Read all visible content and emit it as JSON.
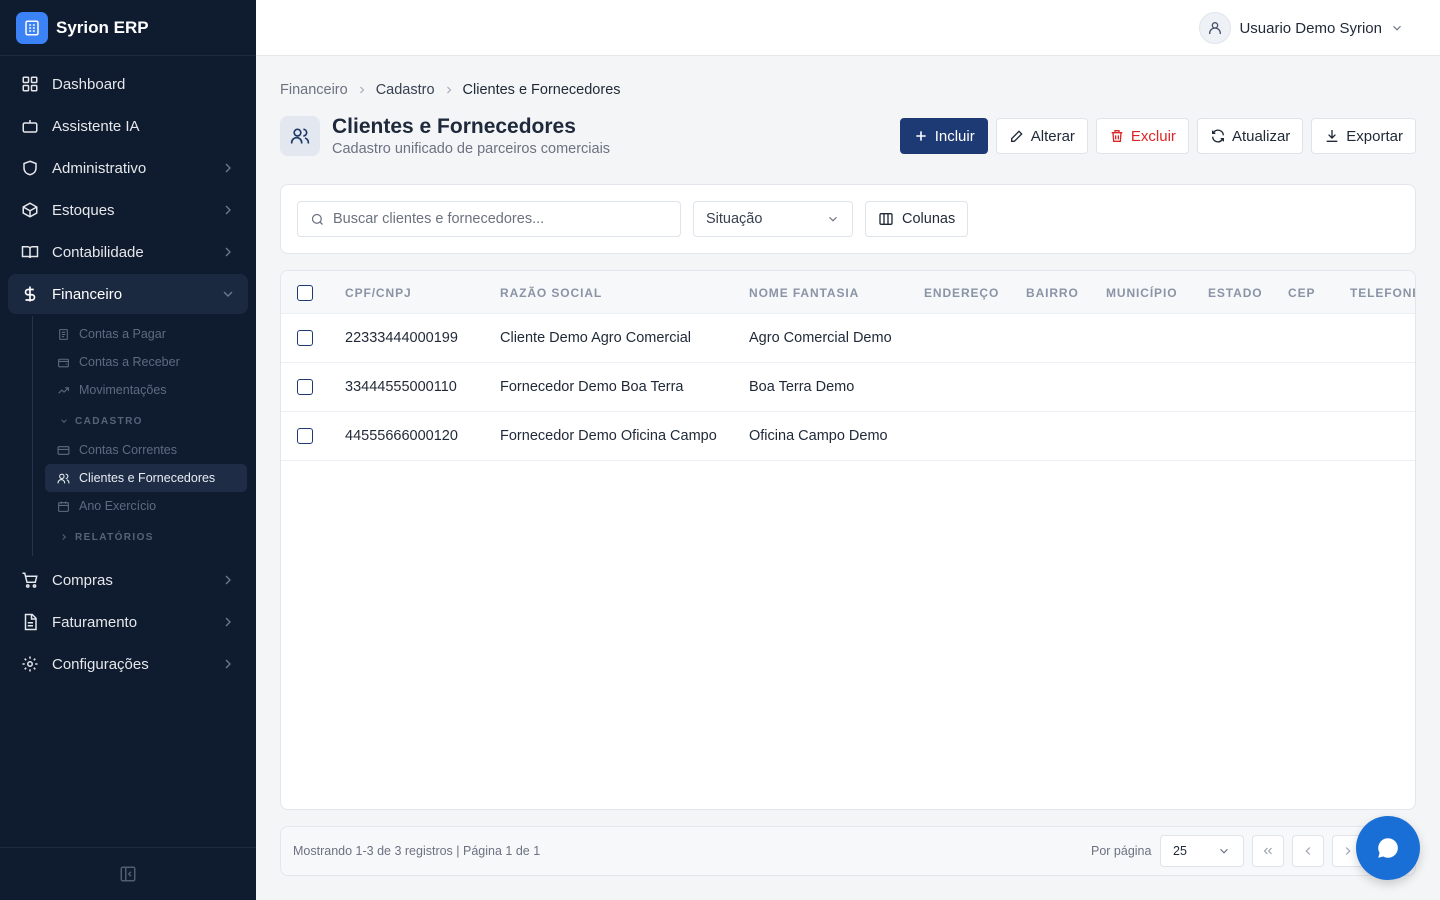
{
  "app": {
    "name": "Syrion ERP"
  },
  "sidebar": {
    "items": [
      {
        "label": "Dashboard",
        "icon": "dashboard-icon"
      },
      {
        "label": "Assistente IA",
        "icon": "bot-icon"
      },
      {
        "label": "Administrativo",
        "icon": "shield-icon"
      },
      {
        "label": "Estoques",
        "icon": "box-icon"
      },
      {
        "label": "Contabilidade",
        "icon": "book-icon"
      },
      {
        "label": "Financeiro",
        "icon": "dollar-icon"
      },
      {
        "label": "Compras",
        "icon": "cart-icon"
      },
      {
        "label": "Faturamento",
        "icon": "invoice-icon"
      },
      {
        "label": "Configurações",
        "icon": "gear-icon"
      }
    ],
    "financeiro_sub": {
      "items": [
        "Contas a Pagar",
        "Contas a Receber",
        "Movimentações"
      ],
      "group_cadastro": "CADASTRO",
      "cadastro_items": [
        "Contas Correntes",
        "Clientes e Fornecedores",
        "Ano Exercício"
      ],
      "group_relatorios": "RELATÓRIOS"
    }
  },
  "topbar": {
    "user_name": "Usuario Demo Syrion"
  },
  "breadcrumb": [
    "Financeiro",
    "Cadastro",
    "Clientes e Fornecedores"
  ],
  "page": {
    "title": "Clientes e Fornecedores",
    "subtitle": "Cadastro unificado de parceiros comerciais"
  },
  "actions": {
    "incluir": "Incluir",
    "alterar": "Alterar",
    "excluir": "Excluir",
    "atualizar": "Atualizar",
    "exportar": "Exportar"
  },
  "filters": {
    "search_placeholder": "Buscar clientes e fornecedores...",
    "situacao": "Situação",
    "colunas": "Colunas"
  },
  "table": {
    "columns": [
      "CPF/CNPJ",
      "Razão Social",
      "Nome Fantasia",
      "Endereço",
      "Bairro",
      "Município",
      "Estado",
      "CEP",
      "Telefone"
    ],
    "rows": [
      {
        "cpf_cnpj": "22333444000199",
        "razao_social": "Cliente Demo Agro Comercial",
        "nome_fantasia": "Agro Comercial Demo"
      },
      {
        "cpf_cnpj": "33444555000110",
        "razao_social": "Fornecedor Demo Boa Terra",
        "nome_fantasia": "Boa Terra Demo"
      },
      {
        "cpf_cnpj": "44555666000120",
        "razao_social": "Fornecedor Demo Oficina Campo",
        "nome_fantasia": "Oficina Campo Demo"
      }
    ]
  },
  "pagination": {
    "info": "Mostrando 1-3 de 3 registros | Página 1 de 1",
    "per_page_label": "Por página",
    "per_page_value": "25"
  },
  "colors": {
    "sidebar_bg": "#0f1b2e",
    "primary": "#1e3a74",
    "danger": "#dc2626",
    "chat_fab": "#1a6fd6"
  }
}
